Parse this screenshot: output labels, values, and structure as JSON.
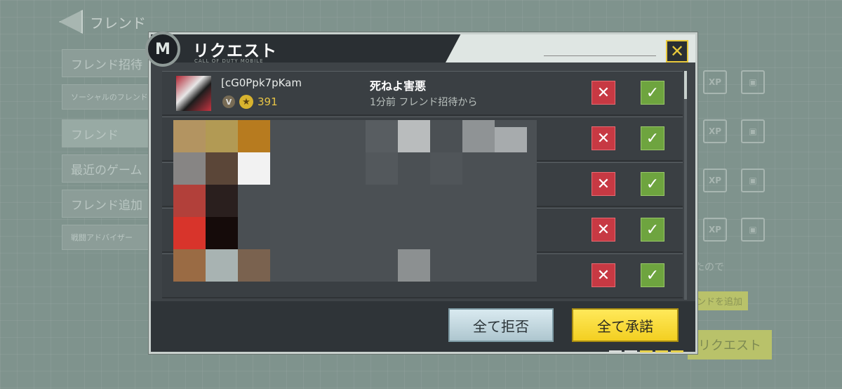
{
  "background": {
    "title": "フレンド",
    "sidebar": [
      "フレンド招待",
      "ソーシャルのフレンド",
      "フレンド",
      "最近のゲーム",
      "フレンド追加",
      "戦闘アドバイザー"
    ],
    "right_tab": "リクエスト",
    "right_text": "たので",
    "right_button": "ンドを追加",
    "chip_xp": "XP"
  },
  "dialog": {
    "title": "リクエスト",
    "subtitle": "CALL OF DUTY MOBILE",
    "logo": "M",
    "close_icon": "✕",
    "requests": [
      {
        "name": "[cG0Ppk7pKam",
        "rank_icon": "V",
        "level": "391",
        "message": "死ねよ害悪",
        "time": "1分前 フレンド招待から"
      },
      {
        "name": "",
        "rank_icon": "",
        "level": "",
        "message": "",
        "time": ""
      },
      {
        "name": "",
        "rank_icon": "",
        "level": "",
        "message": "",
        "time": ""
      },
      {
        "name": "",
        "rank_icon": "",
        "level": "",
        "message": "",
        "time": ""
      },
      {
        "name": "",
        "rank_icon": "",
        "level": "",
        "message": "",
        "time": ""
      }
    ],
    "reject_icon": "✕",
    "accept_icon": "✓",
    "reject_all": "全て拒否",
    "accept_all": "全て承諾"
  },
  "colors": {
    "accent_yellow": "#f3cf21",
    "reject_red": "#c73943",
    "accept_green": "#6ea43f"
  }
}
